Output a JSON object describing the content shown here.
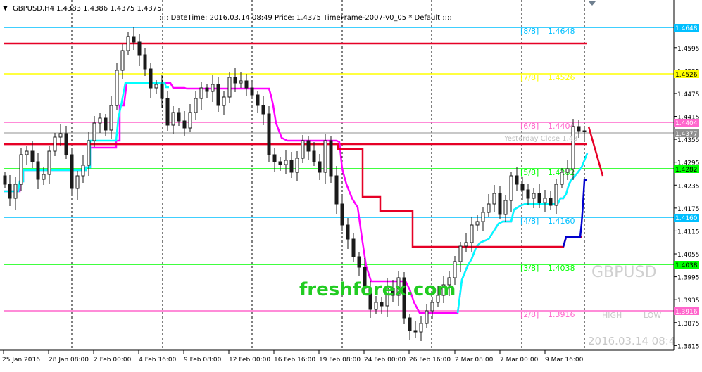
{
  "header": {
    "symbol_label": "GBPUSD,H4",
    "ohlc": "1.4383 1.4386 1.4375 1.4375",
    "info": ":::: DateTime: 2016.03.14 08:49   Price: 1.4375   TimeFrame-2007-v0_05   *  Default ::::"
  },
  "watermark": {
    "brand": "freshforex.com",
    "symbol": "GBPUSD",
    "high_label": "HIGH",
    "low_label": "LOW",
    "datetime": "2016.03.14 08:4"
  },
  "axis": {
    "price_ticks": [
      "1.4595",
      "1.4535",
      "1.4475",
      "1.4415",
      "1.4355",
      "1.4295",
      "1.4235",
      "1.4175",
      "1.4115",
      "1.4055",
      "1.3995",
      "1.3935",
      "1.3875",
      "1.3815"
    ],
    "time_ticks": [
      "25 Jan 2016",
      "28 Jan 08:00",
      "2 Feb 00:00",
      "4 Feb 16:00",
      "9 Feb 08:00",
      "12 Feb 00:00",
      "16 Feb 16:00",
      "19 Feb 08:00",
      "24 Feb 00:00",
      "26 Feb 16:00",
      "2 Mar 08:00",
      "7 Mar 00:00",
      "9 Mar 16:00"
    ]
  },
  "levels": [
    {
      "name": "[8/8]",
      "value": "1.4648",
      "color": "#00bfff"
    },
    {
      "name": "",
      "value": "",
      "color": "#e60026"
    },
    {
      "name": "[7/8]",
      "value": "1.4526",
      "color": "#ffff00"
    },
    {
      "name": "[6/8]",
      "value": "1.4404",
      "color": "#ff66cc"
    },
    {
      "name": "",
      "value": "",
      "color": "#e60026"
    },
    {
      "name": "[5/8]",
      "value": "1.4282",
      "color": "#00ff00"
    },
    {
      "name": "[4/8]",
      "value": "1.4160",
      "color": "#00bfff"
    },
    {
      "name": "[3/8]",
      "value": "1.4038",
      "color": "#00ff00"
    },
    {
      "name": "[2/8]",
      "value": "1.3916",
      "color": "#ff66cc"
    }
  ],
  "current_price": {
    "value": "1.4377",
    "color": "#909090"
  },
  "yesterday_close": "Yesterday Close 1.43",
  "colors": {
    "background": "#ffffff",
    "candle": "#1a1a1a",
    "trail_red": "#e60026",
    "trail_magenta": "#ff00ff",
    "trail_cyan": "#00ffff",
    "trail_blue": "#0000cd",
    "grid": "#000000"
  }
}
